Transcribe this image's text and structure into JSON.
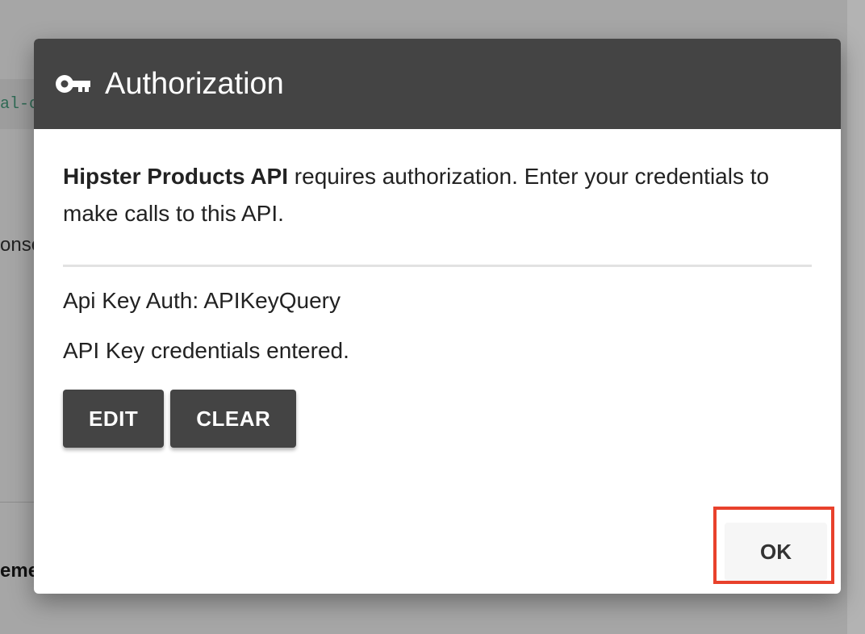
{
  "background": {
    "code_snippet": "al-c",
    "response_fragment": "onse",
    "element_fragment": "eme"
  },
  "dialog": {
    "title": "Authorization",
    "icon": "key-icon",
    "intro_api_name": "Hipster Products API",
    "intro_text": " requires authorization. Enter your credentials to make calls to this API.",
    "auth_scheme": "Api Key Auth: APIKeyQuery",
    "auth_status": "API Key credentials entered.",
    "edit_label": "EDIT",
    "clear_label": "CLEAR",
    "ok_label": "OK"
  },
  "colors": {
    "header_bg": "#444444",
    "button_dark": "#444444",
    "highlight": "#e8412c"
  }
}
